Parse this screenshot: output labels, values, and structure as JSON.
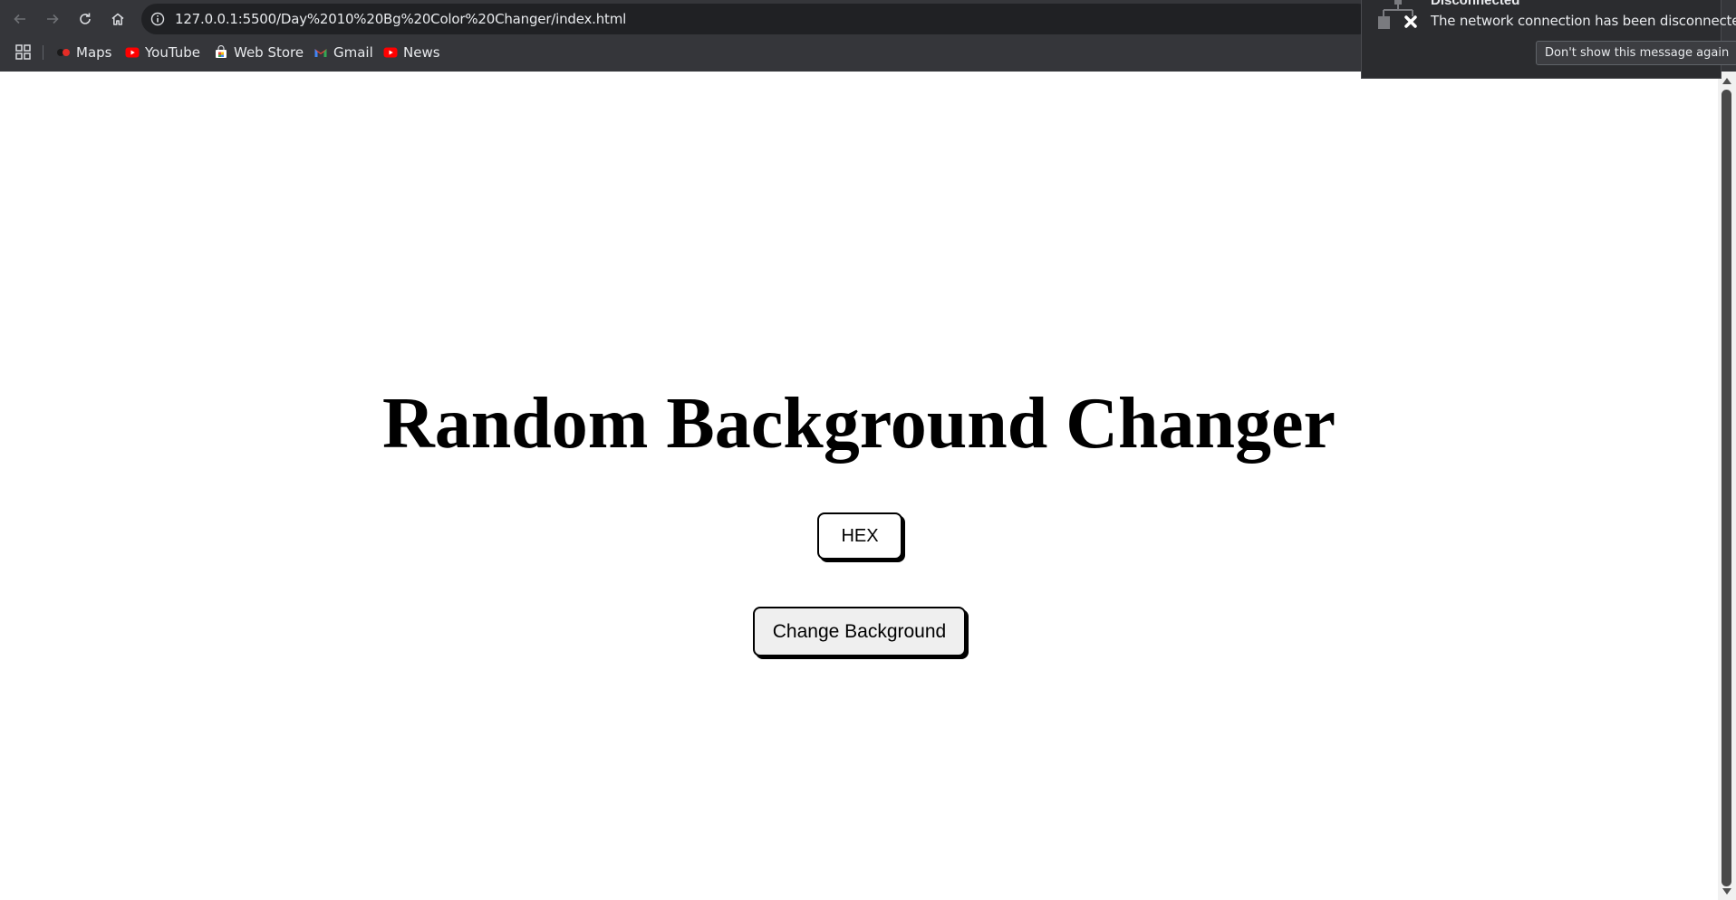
{
  "browser": {
    "url": "127.0.0.1:5500/Day%2010%20Bg%20Color%20Changer/index.html",
    "bookmarks": [
      {
        "label": "Maps",
        "icon": "maps-icon"
      },
      {
        "label": "YouTube",
        "icon": "youtube-icon"
      },
      {
        "label": "Web Store",
        "icon": "web-store-icon"
      },
      {
        "label": "Gmail",
        "icon": "gmail-icon"
      },
      {
        "label": "News",
        "icon": "youtube-icon"
      }
    ]
  },
  "notification": {
    "title": "Disconnected",
    "message": "The network connection has been disconnected.",
    "dismiss_label": "Don't show this message again",
    "icon": "network-disconnected-icon"
  },
  "page": {
    "title": "Random Background Changer",
    "hex_label": "HEX",
    "change_label": "Change Background",
    "background_color": "#ffffff"
  },
  "colors": {
    "chrome_bg": "#35363a",
    "omnibox_bg": "#202124",
    "notification_bg": "#2b2c2f",
    "youtube_red": "#ff0000"
  }
}
